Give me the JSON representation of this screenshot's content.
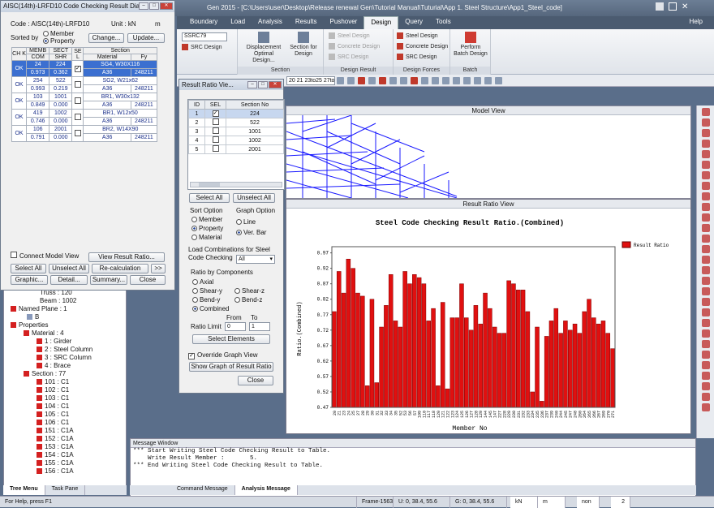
{
  "app": {
    "title": "Gen 2015 - [C:\\Users\\user\\Desktop\\Release renewal Gen\\Tutorial Manual\\Tuturial\\App 1. Steel Structure\\App1_Steel_code]",
    "help": "Help"
  },
  "ribbon": {
    "tabs": [
      "Boundary",
      "Load",
      "Analysis",
      "Results",
      "Pushover",
      "Design",
      "Query",
      "Tools"
    ],
    "active_tab": "Design",
    "code_select": "SSRC79",
    "src_design": "SRC Design",
    "displacement_btn": "Displacement Optimal Design...",
    "section_design_btn": "Section for Design",
    "group_section": "Section",
    "steel_design_gray": "Steel Design",
    "concrete_design_gray": "Concrete Design",
    "src_design_gray": "SRC Design",
    "group_design_result": "Design Result",
    "steel_design": "Steel Design",
    "concrete_design": "Concrete Design",
    "src_design2": "SRC Design",
    "group_design_forces": "Design Forces",
    "perform_batch": "Perform Batch Design",
    "group_batch": "Batch",
    "load_combo_text": "20 21 23to25 27to2"
  },
  "model_view": {
    "title": "Model View"
  },
  "result_view": {
    "title": "Result Ratio View"
  },
  "dialog1": {
    "title": "AISC(14th)-LRFD10 Code Checking Result Dialog",
    "code_label": "Code : AISC(14th)-LRFD10",
    "unit_label": "Unit : kN",
    "unit_m": "m",
    "sorted_by": "Sorted by",
    "opt_member": "Member",
    "opt_property": "Property",
    "change_btn": "Change...",
    "update_btn": "Update...",
    "headers": {
      "chk": "CH K",
      "memb": "MEMB",
      "sect": "SECT",
      "sel": "SE L",
      "section": "Section",
      "com": "COM",
      "shr": "SHR",
      "material": "Material",
      "fy": "Fy"
    },
    "rows": [
      {
        "chk": "OK",
        "memb": "24",
        "sect": "224",
        "com": "0.973",
        "shr": "0.362",
        "checked": "✓",
        "section": "SG4, W30X116",
        "material": "A36",
        "fy": "248211"
      },
      {
        "chk": "OK",
        "memb": "254",
        "sect": "522",
        "com": "0.993",
        "shr": "0.219",
        "checked": "",
        "section": "SG2, W21x62",
        "material": "A36",
        "fy": "248211"
      },
      {
        "chk": "OK",
        "memb": "103",
        "sect": "1001",
        "com": "0.849",
        "shr": "0.000",
        "checked": "",
        "section": "BR1, W30x132",
        "material": "A36",
        "fy": "248211"
      },
      {
        "chk": "OK",
        "memb": "419",
        "sect": "1002",
        "com": "0.746",
        "shr": "0.000",
        "checked": "",
        "section": "BR1, W12x50",
        "material": "A36",
        "fy": "248211"
      },
      {
        "chk": "OK",
        "memb": "106",
        "sect": "2001",
        "com": "0.791",
        "shr": "0.000",
        "checked": "",
        "section": "BR2, W14X90",
        "material": "A36",
        "fy": "248211"
      }
    ],
    "connect_model": "Connect Model View",
    "view_result_ratio": "View Result Ratio...",
    "select_all": "Select All",
    "unselect_all": "Unselect All",
    "recalc": "Re-calculation",
    "more": ">>",
    "graphic": "Graphic...",
    "detail": "Detail...",
    "summary": "Summary...",
    "close": "Close"
  },
  "dialog2": {
    "title": "Result Ratio Vie...",
    "headers": [
      "ID",
      "SEL",
      "Section No"
    ],
    "rows": [
      {
        "id": "1",
        "sel": "✓",
        "sec": "224"
      },
      {
        "id": "2",
        "sel": "",
        "sec": "522"
      },
      {
        "id": "3",
        "sel": "",
        "sec": "1001"
      },
      {
        "id": "4",
        "sel": "",
        "sec": "1002"
      },
      {
        "id": "5",
        "sel": "",
        "sec": "2001"
      }
    ],
    "select_all": "Select All",
    "unselect_all": "Unselect All",
    "sort_option": "Sort Option",
    "sort_member": "Member",
    "sort_property": "Property",
    "sort_material": "Material",
    "graph_option": "Graph Option",
    "graph_line": "Line",
    "graph_bar": "Ver. Bar",
    "load_combo_label": "Load Combinations for Steel Code Checking",
    "load_combo_value": "All",
    "ratio_by": "Ratio by Components",
    "axial": "Axial",
    "shear_y": "Shear-y",
    "shear_z": "Shear-z",
    "bend_y": "Bend-y",
    "bend_z": "Bend-z",
    "combined": "Combined",
    "from_label": "From",
    "to_label": "To",
    "ratio_limit": "Ratio Limit",
    "from_val": "0",
    "to_val": "1",
    "select_elements": "Select Elements",
    "override": "Override Graph View",
    "show_graph": "Show Graph of Result Ratio",
    "close": "Close"
  },
  "tree": {
    "items": [
      "Truss : 120",
      "Beam : 1002",
      "Named Plane : 1",
      "B",
      "Properties",
      "Material : 4",
      "1 : Girder",
      "2 : Steel Column",
      "3 : SRC Column",
      "4 : Brace",
      "Section : 77",
      "101 : C1",
      "102 : C1",
      "103 : C1",
      "104 : C1",
      "105 : C1",
      "106 : C1",
      "151 : C1A",
      "152 : C1A",
      "153 : C1A",
      "154 : C1A",
      "155 : C1A",
      "156 : C1A"
    ],
    "tab_tree": "Tree Menu",
    "tab_task": "Task Pane"
  },
  "message": {
    "title": "Message Window",
    "lines": [
      "*** Start Writing Steel Code Checking Result to Table.",
      "    Write Result Member :       5.",
      "*** End Writing Steel Code Checking Result to Table."
    ],
    "tab_command": "Command Message",
    "tab_analysis": "Analysis Message"
  },
  "status": {
    "help": "For Help, press F1",
    "frame": "Frame-1563",
    "u": "U: 0, 38.4, 55.6",
    "g": "G: 0, 38.4, 55.6",
    "unit_force": "kN",
    "unit_len": "m",
    "none": "non",
    "page": "2"
  },
  "chart_data": {
    "type": "bar",
    "title": "Steel Code Checking Result Ratio.(Combined)",
    "xlabel": "Member No",
    "ylabel": "Ratio.(Combined)",
    "legend": "Result Ratio",
    "legend_position": "top-right",
    "ylim": [
      0.47,
      0.99
    ],
    "yticks": [
      0.47,
      0.52,
      0.57,
      0.62,
      0.67,
      0.72,
      0.77,
      0.82,
      0.87,
      0.92,
      0.97
    ],
    "bar_color": "#e01010",
    "categories": [
      "20",
      "21",
      "23",
      "24",
      "25",
      "27",
      "28",
      "29",
      "30",
      "31",
      "32",
      "33",
      "34",
      "35",
      "52",
      "53",
      "56",
      "57",
      "109",
      "110",
      "117",
      "118",
      "120",
      "121",
      "122",
      "123",
      "124",
      "125",
      "126",
      "127",
      "128",
      "129",
      "144",
      "145",
      "147",
      "227",
      "228",
      "229",
      "230",
      "231",
      "232",
      "233",
      "234",
      "235",
      "236",
      "237",
      "239",
      "240",
      "244",
      "245",
      "247",
      "248",
      "260",
      "264",
      "265",
      "266",
      "267",
      "269",
      "270",
      "271"
    ],
    "values": [
      0.78,
      0.91,
      0.84,
      0.95,
      0.92,
      0.84,
      0.83,
      0.54,
      0.82,
      0.55,
      0.73,
      0.8,
      0.9,
      0.75,
      0.73,
      0.91,
      0.87,
      0.9,
      0.89,
      0.87,
      0.75,
      0.79,
      0.54,
      0.81,
      0.53,
      0.76,
      0.76,
      0.87,
      0.76,
      0.72,
      0.8,
      0.74,
      0.84,
      0.79,
      0.73,
      0.71,
      0.71,
      0.88,
      0.87,
      0.85,
      0.85,
      0.78,
      0.52,
      0.73,
      0.49,
      0.7,
      0.75,
      0.79,
      0.71,
      0.75,
      0.72,
      0.74,
      0.71,
      0.78,
      0.82,
      0.76,
      0.74,
      0.75,
      0.71,
      0.66
    ]
  }
}
